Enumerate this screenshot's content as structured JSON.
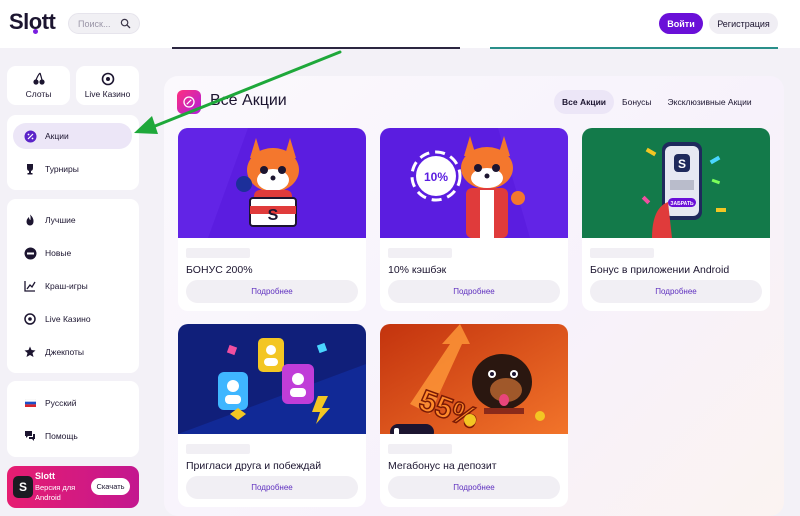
{
  "header": {
    "logo": "Slott",
    "search_placeholder": "Поиск...",
    "login_label": "Войти",
    "register_label": "Регистрация"
  },
  "sidebar": {
    "tiles": [
      {
        "label": "Слоты",
        "icon": "cherries-icon"
      },
      {
        "label": "Live Казино",
        "icon": "roulette-icon"
      }
    ],
    "group1": [
      {
        "label": "Акции",
        "icon": "promo-icon",
        "active": true
      },
      {
        "label": "Турниры",
        "icon": "trophy-icon"
      }
    ],
    "group2": [
      {
        "label": "Лучшие",
        "icon": "flame-icon"
      },
      {
        "label": "Новые",
        "icon": "new-badge-icon"
      },
      {
        "label": "Краш-игры",
        "icon": "chart-up-icon"
      },
      {
        "label": "Live Казино",
        "icon": "roulette-icon"
      },
      {
        "label": "Джекпоты",
        "icon": "jackpot-icon"
      }
    ],
    "group3": [
      {
        "label": "Русский",
        "icon": "russia-flag-icon"
      },
      {
        "label": "Помощь",
        "icon": "chat-icon"
      }
    ],
    "app_banner": {
      "title": "Slott",
      "subtitle_line1": "Версия для",
      "subtitle_line2": "Android",
      "button_label": "Скачать"
    }
  },
  "main": {
    "title": "Все Акции",
    "tabs": [
      {
        "label": "Все Акции",
        "active": true
      },
      {
        "label": "Бонусы"
      },
      {
        "label": "Эксклюзивные Акции"
      }
    ],
    "cards": [
      {
        "title": "БОНУС 200%",
        "button": "Подробнее",
        "image_text": "S"
      },
      {
        "title": "10% кэшбэк",
        "button": "Подробнее",
        "image_text": "10%"
      },
      {
        "title": "Бонус в приложении Android",
        "button": "Подробнее",
        "image_text": "ЗАБРАТЬ"
      },
      {
        "title": "Пригласи друга и побеждай",
        "button": "Подробнее"
      },
      {
        "title": "Мегабонус на депозит",
        "button": "Подробнее",
        "image_text": "55%"
      }
    ]
  },
  "colors": {
    "brand_purple": "#6a0fd8",
    "promo_purple": "#5b1de0",
    "app_green": "#137a4a",
    "deposit_orange": "#e8541c",
    "annotation_arrow": "#1ea83a"
  }
}
